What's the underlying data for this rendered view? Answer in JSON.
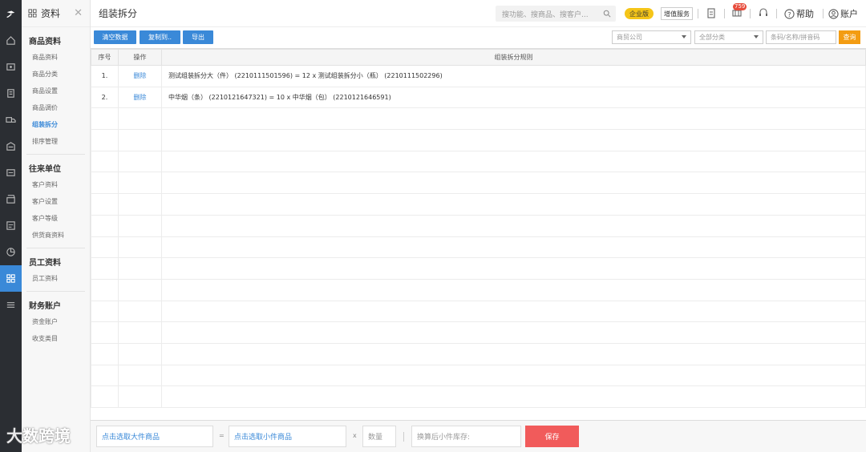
{
  "sidebar": {
    "module_title": "资料",
    "groups": [
      {
        "title": "商品资料",
        "items": [
          "商品资料",
          "商品分类",
          "商品设置",
          "商品调价",
          "组装拆分",
          "排序管理"
        ]
      },
      {
        "title": "往来单位",
        "items": [
          "客户资料",
          "客户设置",
          "客户等级",
          "供货商资料"
        ]
      },
      {
        "title": "员工资料",
        "items": [
          "员工资料"
        ]
      },
      {
        "title": "财务账户",
        "items": [
          "资金账户",
          "收支类目"
        ]
      }
    ]
  },
  "header": {
    "page_title": "组装拆分",
    "search_placeholder": "搜功能、搜商品、搜客户...",
    "edition_badge": "企业版",
    "addon_button": "增值服务",
    "notification_count": "759",
    "help_label": "帮助",
    "account_label": "账户"
  },
  "toolbar": {
    "clear_label": "清空数据",
    "copy_label": "复制到..",
    "export_label": "导出",
    "company_select": "商贸公司",
    "category_select": "全部分类",
    "code_placeholder": "条码/名称/拼音码",
    "query_label": "查询"
  },
  "table": {
    "columns": [
      "序号",
      "操作",
      "组装拆分规则"
    ],
    "rows": [
      {
        "index": "1.",
        "action": "删除",
        "rule": "测试组装拆分大（件） (2210111501596)  = 12 x 测试组装拆分小（瓶） (2210111502296)"
      },
      {
        "index": "2.",
        "action": "删除",
        "rule": "中华烟（条） (2210121647321)  = 10 x 中华烟（包） (2210121646591)"
      }
    ]
  },
  "bottom": {
    "big_item_placeholder": "点击选取大件商品",
    "eq": "=",
    "small_item_placeholder": "点击选取小件商品",
    "times": "x",
    "qty_placeholder": "数量",
    "stock_placeholder": "换算后小件库存:",
    "save_label": "保存"
  },
  "watermark": "大数跨境",
  "colors": {
    "accent": "#3a89d8",
    "save": "#f15b5b",
    "query": "#f39c12",
    "badge": "#f5c518",
    "rail": "#2b2e33"
  }
}
